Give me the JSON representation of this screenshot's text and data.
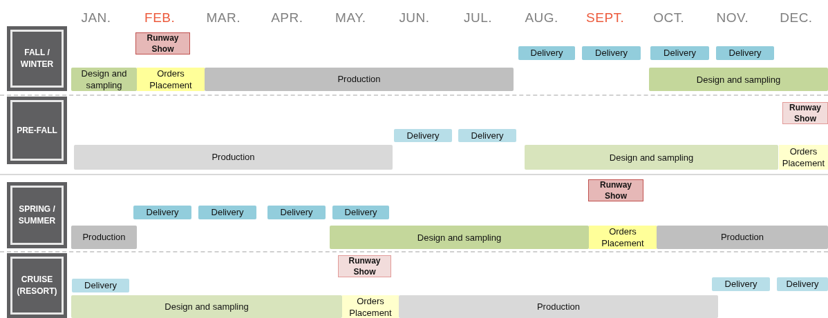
{
  "months": [
    {
      "label": "JAN.",
      "highlighted": false
    },
    {
      "label": "FEB.",
      "highlighted": true
    },
    {
      "label": "MAR.",
      "highlighted": false
    },
    {
      "label": "APR.",
      "highlighted": false
    },
    {
      "label": "MAY.",
      "highlighted": false
    },
    {
      "label": "JUN.",
      "highlighted": false
    },
    {
      "label": "JUL.",
      "highlighted": false
    },
    {
      "label": "AUG.",
      "highlighted": false
    },
    {
      "label": "SEPT.",
      "highlighted": true
    },
    {
      "label": "OCT.",
      "highlighted": false
    },
    {
      "label": "NOV.",
      "highlighted": false
    },
    {
      "label": "DEC.",
      "highlighted": false
    }
  ],
  "seasons": [
    {
      "name": "FALL / WINTER",
      "muted": false,
      "items": [
        {
          "kind": "runway",
          "label": "Runway Show"
        },
        {
          "kind": "delivery",
          "label": "Delivery"
        },
        {
          "kind": "delivery",
          "label": "Delivery"
        },
        {
          "kind": "delivery",
          "label": "Delivery"
        },
        {
          "kind": "delivery",
          "label": "Delivery"
        },
        {
          "kind": "design",
          "label": "Design and sampling"
        },
        {
          "kind": "orders",
          "label": "Orders Placement"
        },
        {
          "kind": "production",
          "label": "Production"
        },
        {
          "kind": "design",
          "label": "Design and sampling"
        }
      ]
    },
    {
      "name": "PRE-FALL",
      "muted": true,
      "items": [
        {
          "kind": "runway",
          "label": "Runway Show"
        },
        {
          "kind": "delivery",
          "label": "Delivery"
        },
        {
          "kind": "delivery",
          "label": "Delivery"
        },
        {
          "kind": "production",
          "label": "Production"
        },
        {
          "kind": "design",
          "label": "Design and sampling"
        },
        {
          "kind": "orders",
          "label": "Orders Placement"
        }
      ]
    },
    {
      "name": "SPRING / SUMMER",
      "muted": false,
      "items": [
        {
          "kind": "runway",
          "label": "Runway Show"
        },
        {
          "kind": "delivery",
          "label": "Delivery"
        },
        {
          "kind": "delivery",
          "label": "Delivery"
        },
        {
          "kind": "delivery",
          "label": "Delivery"
        },
        {
          "kind": "delivery",
          "label": "Delivery"
        },
        {
          "kind": "production",
          "label": "Production"
        },
        {
          "kind": "design",
          "label": "Design and sampling"
        },
        {
          "kind": "orders",
          "label": "Orders Placement"
        },
        {
          "kind": "production",
          "label": "Production"
        }
      ]
    },
    {
      "name": "CRUISE (RESORT)",
      "muted": true,
      "items": [
        {
          "kind": "runway",
          "label": "Runway Show"
        },
        {
          "kind": "delivery",
          "label": "Delivery"
        },
        {
          "kind": "delivery",
          "label": "Delivery"
        },
        {
          "kind": "delivery",
          "label": "Delivery"
        },
        {
          "kind": "design",
          "label": "Design and sampling"
        },
        {
          "kind": "orders",
          "label": "Orders Placement"
        },
        {
          "kind": "production",
          "label": "Production"
        }
      ]
    }
  ]
}
